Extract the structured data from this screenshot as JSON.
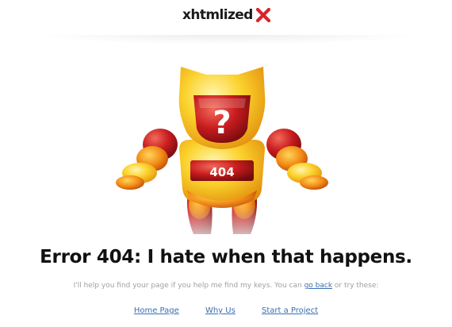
{
  "header": {
    "logo_text": "xhtmlized",
    "logo_mark_icon": "x-mark-icon",
    "accent_color": "#d9252a"
  },
  "illustration": {
    "robot_icon": "robot-mascot",
    "badge_text": "404",
    "face_symbol": "?"
  },
  "main": {
    "headline": "Error 404: I hate when that happens.",
    "subline_before": "I'll help you find your page if you help me find my keys. You can",
    "go_back_label": "go back",
    "subline_after": "or try these:"
  },
  "links": [
    {
      "label": "Home Page"
    },
    {
      "label": "Why Us"
    },
    {
      "label": "Start a Project"
    }
  ],
  "colors": {
    "link": "#3a6fb0",
    "robot_yellow": "#f6c21d",
    "robot_red": "#c0141b",
    "robot_orange": "#ee7b12"
  }
}
